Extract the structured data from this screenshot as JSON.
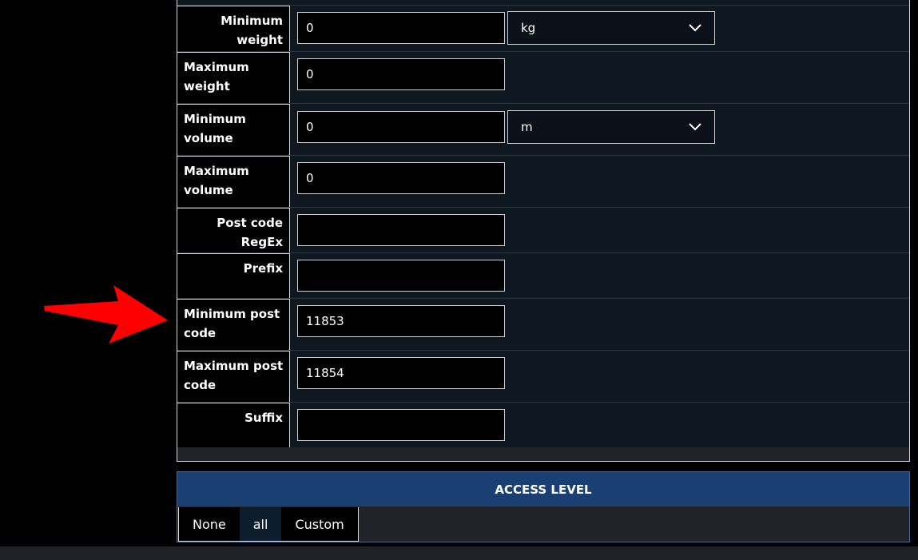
{
  "form": {
    "rows": [
      {
        "label": "Minimum weight",
        "value": "0",
        "unit": "kg"
      },
      {
        "label": "Maximum weight",
        "value": "0"
      },
      {
        "label": "Minimum volume",
        "value": "0",
        "unit": "m"
      },
      {
        "label": "Maximum volume",
        "value": "0"
      },
      {
        "label": "Post code RegEx",
        "value": ""
      },
      {
        "label": "Prefix",
        "value": ""
      },
      {
        "label": "Minimum post code",
        "value": "11853"
      },
      {
        "label": "Maximum post code",
        "value": "11854"
      },
      {
        "label": "Suffix",
        "value": ""
      }
    ]
  },
  "access": {
    "title": "ACCESS LEVEL",
    "tabs": [
      "None",
      "all",
      "Custom"
    ],
    "selected": "all"
  },
  "annotation": {
    "arrow_color": "#ff0000",
    "arrow_icon": "red-arrow-icon"
  },
  "colors": {
    "header": "#1a3f73",
    "panel": "#0f1820"
  }
}
